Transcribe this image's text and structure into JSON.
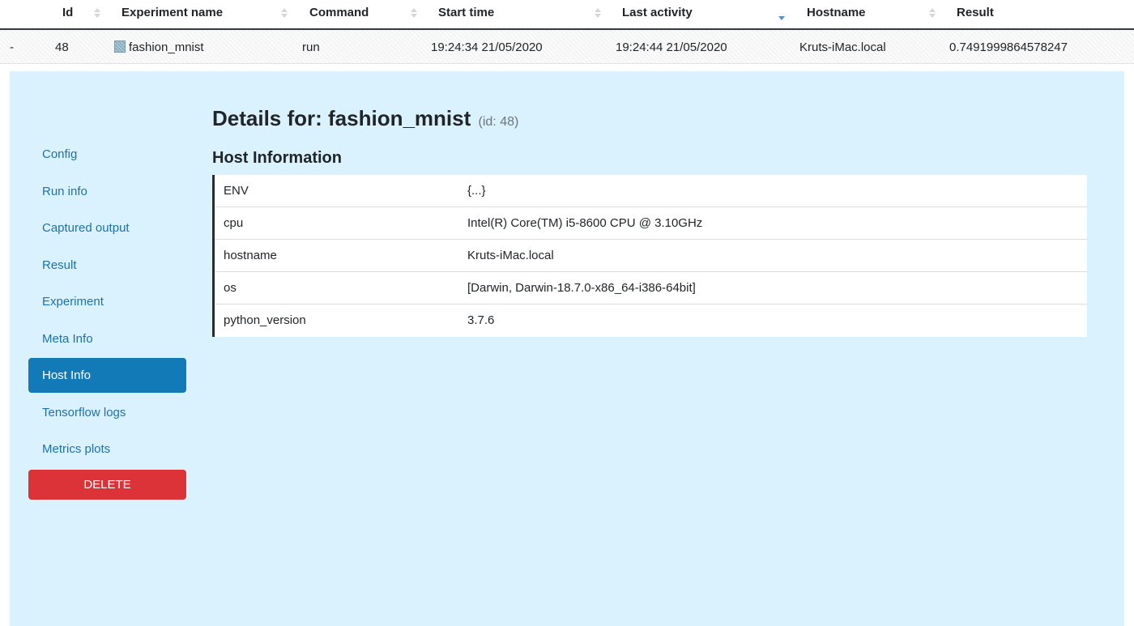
{
  "table": {
    "columns": [
      {
        "label": "Id",
        "sort": "none"
      },
      {
        "label": "Experiment name",
        "sort": "none"
      },
      {
        "label": "Command",
        "sort": "none"
      },
      {
        "label": "Start time",
        "sort": "none"
      },
      {
        "label": "Last activity",
        "sort": "descending"
      },
      {
        "label": "Hostname",
        "sort": "none"
      },
      {
        "label": "Result",
        "sort": "none"
      }
    ],
    "row": {
      "expand": "-",
      "id": "48",
      "experiment_name": "fashion_mnist",
      "command": "run",
      "start_time": "19:24:34 21/05/2020",
      "last_activity": "19:24:44 21/05/2020",
      "hostname": "Kruts-iMac.local",
      "result": "0.7491999864578247"
    }
  },
  "details": {
    "title_prefix": "Details for: fashion_mnist",
    "title_id": "(id: 48)",
    "section_title": "Host Information",
    "nav": [
      {
        "label": "Config",
        "active": false
      },
      {
        "label": "Run info",
        "active": false
      },
      {
        "label": "Captured output",
        "active": false
      },
      {
        "label": "Result",
        "active": false
      },
      {
        "label": "Experiment",
        "active": false
      },
      {
        "label": "Meta Info",
        "active": false
      },
      {
        "label": "Host Info",
        "active": true
      },
      {
        "label": "Tensorflow logs",
        "active": false
      },
      {
        "label": "Metrics plots",
        "active": false
      }
    ],
    "delete_label": "DELETE",
    "host_info": [
      {
        "key": "ENV",
        "value": "{...}"
      },
      {
        "key": "cpu",
        "value": "Intel(R) Core(TM) i5-8600 CPU @ 3.10GHz"
      },
      {
        "key": "hostname",
        "value": "Kruts-iMac.local"
      },
      {
        "key": "os",
        "value": "[Darwin, Darwin-18.7.0-x86_64-i386-64bit]"
      },
      {
        "key": "python_version",
        "value": "3.7.6"
      }
    ]
  },
  "colors": {
    "panel_bg": "#d9f2fd",
    "nav_link": "#1f70a8",
    "nav_active_bg": "#137ab8",
    "delete_bg": "#dc3339",
    "sort_active": "#5a8fc2"
  }
}
